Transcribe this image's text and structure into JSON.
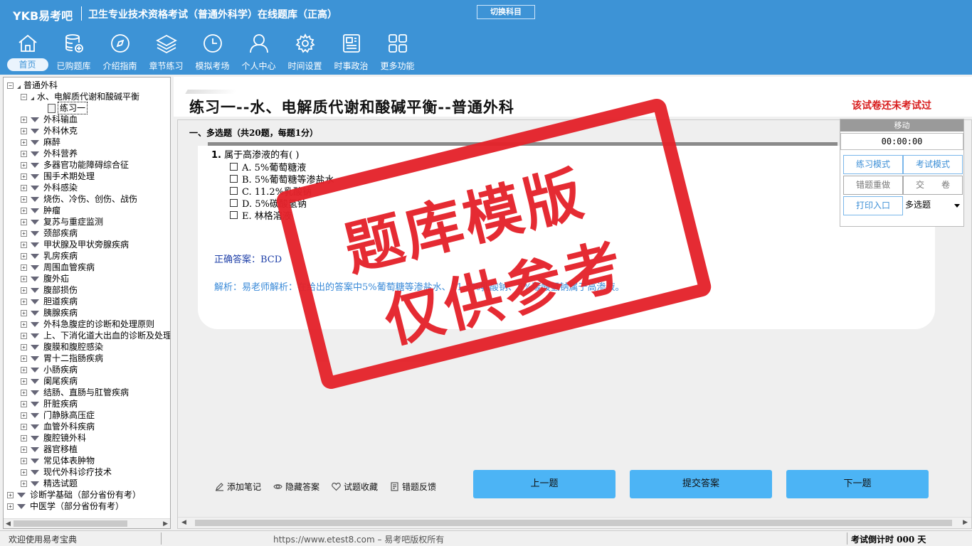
{
  "header": {
    "brand": "YKB易考吧",
    "title": "卫生专业技术资格考试（普通外科学）在线题库（正高）",
    "switch_label": "切换科目"
  },
  "nav": [
    {
      "label": "首页",
      "icon": "home-icon",
      "active": true
    },
    {
      "label": "已购题库",
      "icon": "database-icon"
    },
    {
      "label": "介绍指南",
      "icon": "compass-icon"
    },
    {
      "label": "章节练习",
      "icon": "layers-icon"
    },
    {
      "label": "模拟考场",
      "icon": "clock-icon"
    },
    {
      "label": "个人中心",
      "icon": "user-icon"
    },
    {
      "label": "时间设置",
      "icon": "gear-icon"
    },
    {
      "label": "时事政治",
      "icon": "news-icon"
    },
    {
      "label": "更多功能",
      "icon": "grid-icon"
    }
  ],
  "tree": {
    "root": "普通外科",
    "expanded_child": "水、电解质代谢和酸碱平衡",
    "selected_leaf": "练习一",
    "items": [
      "外科输血",
      "外科休克",
      "麻醉",
      "外科营养",
      "多器官功能障碍综合征",
      "围手术期处理",
      "外科感染",
      "烧伤、冷伤、创伤、战伤",
      "肿瘤",
      "复苏与重症监测",
      "颈部疾病",
      "甲状腺及甲状旁腺疾病",
      "乳房疾病",
      "周围血管疾病",
      "腹外疝",
      "腹部损伤",
      "胆道疾病",
      "胰腺疾病",
      "外科急腹症的诊断和处理原则",
      "上、下消化道大出血的诊断及处理",
      "腹膜和腹腔感染",
      "胃十二指肠疾病",
      "小肠疾病",
      "阑尾疾病",
      "结肠、直肠与肛管疾病",
      "肝脏疾病",
      "门静脉高压症",
      "血管外科疾病",
      "腹腔镜外科",
      "器官移植",
      "常见体表肿物",
      "现代外科诊疗技术",
      "精选试题"
    ],
    "other_roots": [
      "诊断学基础（部分省份有考）",
      "中医学（部分省份有考）"
    ]
  },
  "main": {
    "title": "练习一--水、电解质代谢和酸碱平衡--普通外科",
    "status": "该试卷还未考试过",
    "section": "一、多选题（共20题，每题1分）",
    "question_number": "1.",
    "question_text": "属于高渗液的有( )",
    "options": [
      "A. 5%葡萄糖液",
      "B. 5%葡萄糖等渗盐水",
      "C. 11.2%乳酸钠",
      "D. 5%碳酸氢钠",
      "E. 林格溶液"
    ],
    "answer": "正确答案：BCD",
    "analysis": "解析：易老师解析：在给出的答案中5%葡萄糖等渗盐水、11.2%乳酸钠、5%碳酸氢钠属于高渗液。"
  },
  "tools": [
    {
      "label": "添加笔记",
      "icon": "pencil-icon"
    },
    {
      "label": "隐藏答案",
      "icon": "eye-icon"
    },
    {
      "label": "试题收藏",
      "icon": "heart-icon"
    },
    {
      "label": "错题反馈",
      "icon": "feedback-icon"
    }
  ],
  "buttons": {
    "prev": "上一题",
    "submit": "提交答案",
    "next": "下一题"
  },
  "panel": {
    "move": "移动",
    "timer": "00:00:00",
    "practice_mode": "练习模式",
    "exam_mode": "考试模式",
    "redo_wrong": "错题重做",
    "hand_in": "交　　卷",
    "print": "打印入口",
    "question_type": "多选题"
  },
  "stamp": {
    "line1": "题库模版",
    "line2": "仅供参考"
  },
  "status": {
    "welcome": "欢迎使用易考宝典",
    "copyright": "https://www.etest8.com – 易考吧版权所有",
    "countdown": "考试倒计时 000 天"
  }
}
